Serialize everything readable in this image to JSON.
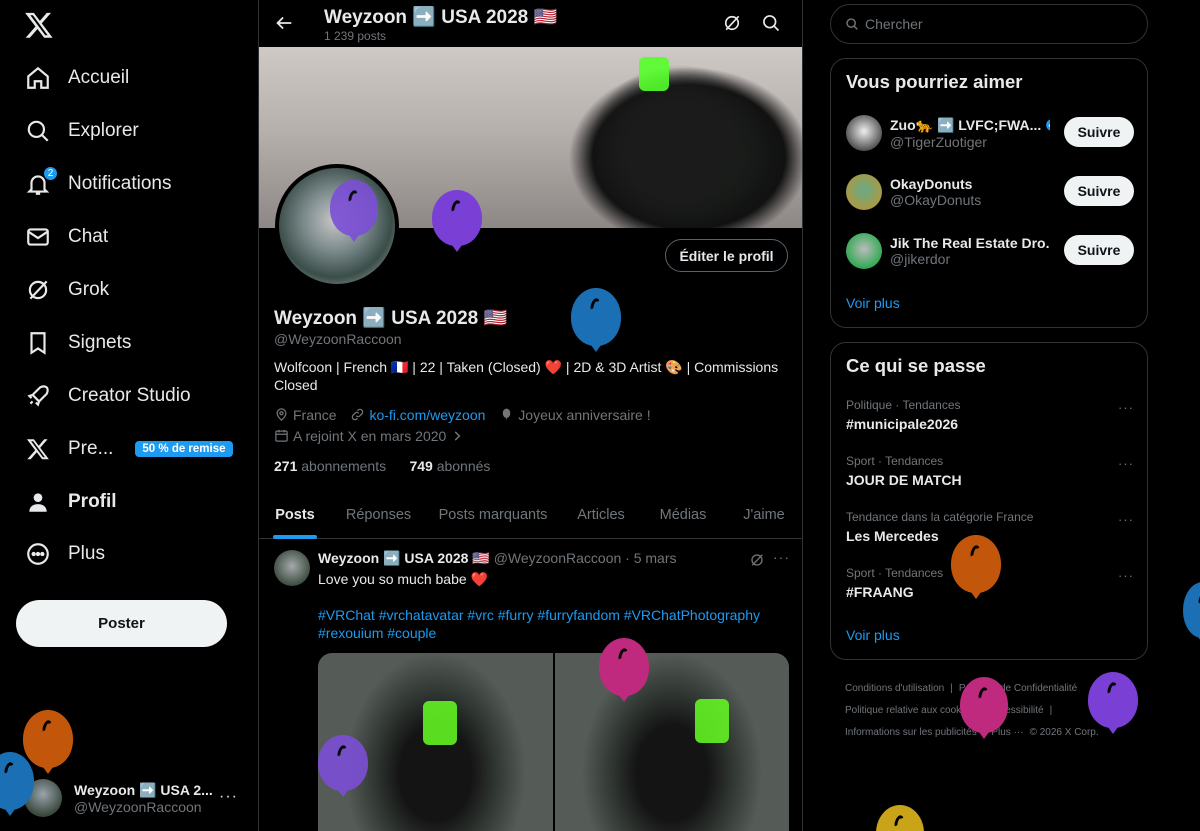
{
  "nav": {
    "items": [
      {
        "label": "Accueil",
        "icon": "home-icon"
      },
      {
        "label": "Explorer",
        "icon": "search-icon"
      },
      {
        "label": "Notifications",
        "icon": "bell-icon",
        "badge": "2"
      },
      {
        "label": "Chat",
        "icon": "mail-icon"
      },
      {
        "label": "Grok",
        "icon": "grok-icon"
      },
      {
        "label": "Signets",
        "icon": "bookmark-icon"
      },
      {
        "label": "Creator Studio",
        "icon": "rocket-icon"
      },
      {
        "label": "Pre...",
        "icon": "x-logo-icon",
        "promo": "50 % de remise"
      },
      {
        "label": "Profil",
        "icon": "person-icon"
      },
      {
        "label": "Plus",
        "icon": "more-circle-icon"
      }
    ],
    "post_label": "Poster",
    "account": {
      "name": "Weyzoon ➡️ USA 2...",
      "handle": "@WeyzoonRaccoon",
      "more": "···"
    }
  },
  "header": {
    "name": "Weyzoon ➡️ USA 2028 🇺🇸",
    "count": "1 239 posts"
  },
  "profile": {
    "edit_label": "Éditer le profil",
    "name": "Weyzoon ➡️ USA 2028 🇺🇸",
    "handle": "@WeyzoonRaccoon",
    "bio": "Wolfcoon | French 🇫🇷 | 22 | Taken (Closed) ❤️ | 2D & 3D Artist 🎨 | Commissions Closed",
    "location": "France",
    "link": "ko-fi.com/weyzoon",
    "birthday": "Joyeux anniversaire !",
    "joined": "A rejoint X en mars 2020",
    "following_count": "271",
    "following_label": "abonnements",
    "followers_count": "749",
    "followers_label": "abonnés"
  },
  "tabs": [
    "Posts",
    "Réponses",
    "Posts marquants",
    "Articles",
    "Médias",
    "J'aime"
  ],
  "tweet": {
    "name": "Weyzoon ➡️ USA 2028 🇺🇸",
    "handle": "@WeyzoonRaccoon",
    "date": "· 5 mars",
    "text": "Love you so much babe ❤️",
    "hashtags": "#VRChat #vrchatavatar #vrc #furry #furryfandom #VRChatPhotography #rexouium #couple"
  },
  "search": {
    "placeholder": "Chercher"
  },
  "who_to_follow": {
    "title": "Vous pourriez aimer",
    "users": [
      {
        "name": "Zuo🐆 ➡️ LVFC;FWA...",
        "handle": "@TigerZuotiger",
        "verified": true
      },
      {
        "name": "OkayDonuts",
        "handle": "@OkayDonuts"
      },
      {
        "name": "Jik The Real Estate Dro...",
        "handle": "@jikerdor"
      }
    ],
    "follow_label": "Suivre",
    "more": "Voir plus"
  },
  "trends": {
    "title": "Ce qui se passe",
    "items": [
      {
        "category": "Politique · Tendances",
        "title": "#municipale2026"
      },
      {
        "category": "Sport · Tendances",
        "title": "JOUR DE MATCH"
      },
      {
        "category": "Tendance dans la catégorie France",
        "title": "Les Mercedes"
      },
      {
        "category": "Sport · Tendances",
        "title": "#FRAANG"
      }
    ],
    "more": "Voir plus"
  },
  "footer": [
    "Conditions d'utilisation",
    "|",
    "Politique de Confidentialité",
    "|",
    "Politique relative aux cookies",
    "|",
    "Accessibilité",
    "|",
    "Informations sur les publicités",
    "|",
    "Plus ···",
    "© 2026 X Corp."
  ],
  "colors": {
    "accent": "#1d9bf0",
    "background": "#000000",
    "border": "#2f3336",
    "muted": "#71767b"
  }
}
